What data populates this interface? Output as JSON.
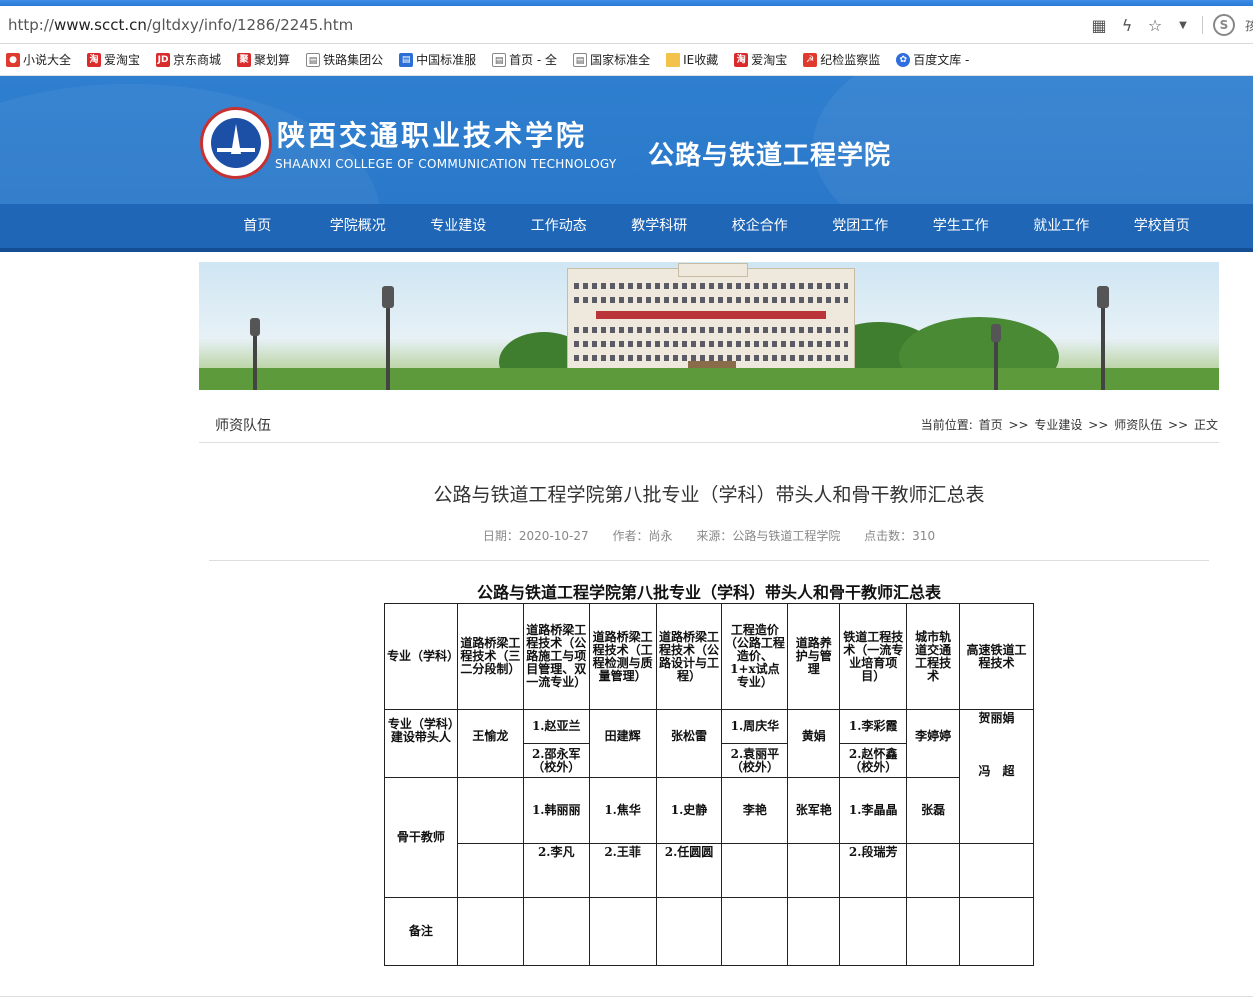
{
  "browser": {
    "url_prefix": "http://",
    "url_host": "www.scct.cn",
    "url_path": "/gltdxy/info/1286/2245.htm"
  },
  "bookmarks": [
    {
      "label": "小说大全",
      "icon": "red-circle-icon"
    },
    {
      "label": "爱淘宝",
      "icon": "taobao-icon"
    },
    {
      "label": "京东商城",
      "icon": "jd-icon"
    },
    {
      "label": "聚划算",
      "icon": "juhuasuan-icon"
    },
    {
      "label": "铁路集团公",
      "icon": "page-icon"
    },
    {
      "label": "中国标准服",
      "icon": "page-blue-icon"
    },
    {
      "label": "首页 - 全",
      "icon": "page-icon"
    },
    {
      "label": "国家标准全",
      "icon": "page-icon"
    },
    {
      "label": "IE收藏",
      "icon": "folder-icon"
    },
    {
      "label": "爱淘宝",
      "icon": "taobao-icon"
    },
    {
      "label": "纪检监察监",
      "icon": "party-icon"
    },
    {
      "label": "百度文库 -",
      "icon": "baidu-icon"
    }
  ],
  "header": {
    "school_cn": "陕西交通职业技术学院",
    "school_en": "SHAANXI COLLEGE OF COMMUNICATION TECHNOLOGY",
    "college": "公路与铁道工程学院"
  },
  "nav": [
    "首页",
    "学院概况",
    "专业建设",
    "工作动态",
    "教学科研",
    "校企合作",
    "党团工作",
    "学生工作",
    "就业工作",
    "学校首页"
  ],
  "section": {
    "name": "师资队伍",
    "loc_label": "当前位置:",
    "crumbs": [
      "首页",
      "专业建设",
      "师资队伍",
      "正文"
    ],
    "sep": ">>"
  },
  "article": {
    "title": "公路与铁道工程学院第八批专业（学科）带头人和骨干教师汇总表",
    "date": "日期：2020-10-27",
    "author": "作者：尚永",
    "source": "来源：公路与铁道工程学院",
    "hits": "点击数：310"
  },
  "table": {
    "title": "公路与铁道工程学院第八批专业（学科）带头人和骨干教师汇总表",
    "col_header": "专业（学科）",
    "majors": [
      "道路桥梁工程技术（三二分段制）",
      "道路桥梁工程技术（公路施工与项目管理、双一流专业）",
      "道路桥梁工程技术（工程检测与质量管理）",
      "道路桥梁工程技术（公路设计与工程）",
      "工程造价（公路工程造价、1+x试点专业）",
      "道路养护与管理",
      "铁道工程技术（一流专业培育项目）",
      "城市轨道交通工程技术",
      "高速铁道工程技术"
    ],
    "leader_label": "专业（学科）建设带头人",
    "leaders": [
      "王愉龙",
      "",
      "田建辉",
      "张松雷",
      "",
      "黄娟",
      "",
      "李婷婷",
      "贺丽娟"
    ],
    "leaders_split": {
      "c2": [
        "1.赵亚兰",
        "2.邵永军（校外）"
      ],
      "c5": [
        "1.周庆华",
        "2.袁丽平（校外）"
      ],
      "c7": [
        "1.李彩霞",
        "2.赵怀鑫（校外）"
      ]
    },
    "leader_extra_c9": "冯　超",
    "backbone_label": "骨干教师",
    "backbone_row1": [
      "",
      "1.韩丽丽",
      "1.焦华",
      "1.史静",
      "李艳",
      "张军艳",
      "1.李晶晶",
      "张磊",
      ""
    ],
    "backbone_row2": [
      "",
      "2.李凡",
      "2.王菲",
      "2.任圆圆",
      "",
      "",
      "2.段瑞芳",
      "",
      ""
    ],
    "remark_label": "备注"
  }
}
